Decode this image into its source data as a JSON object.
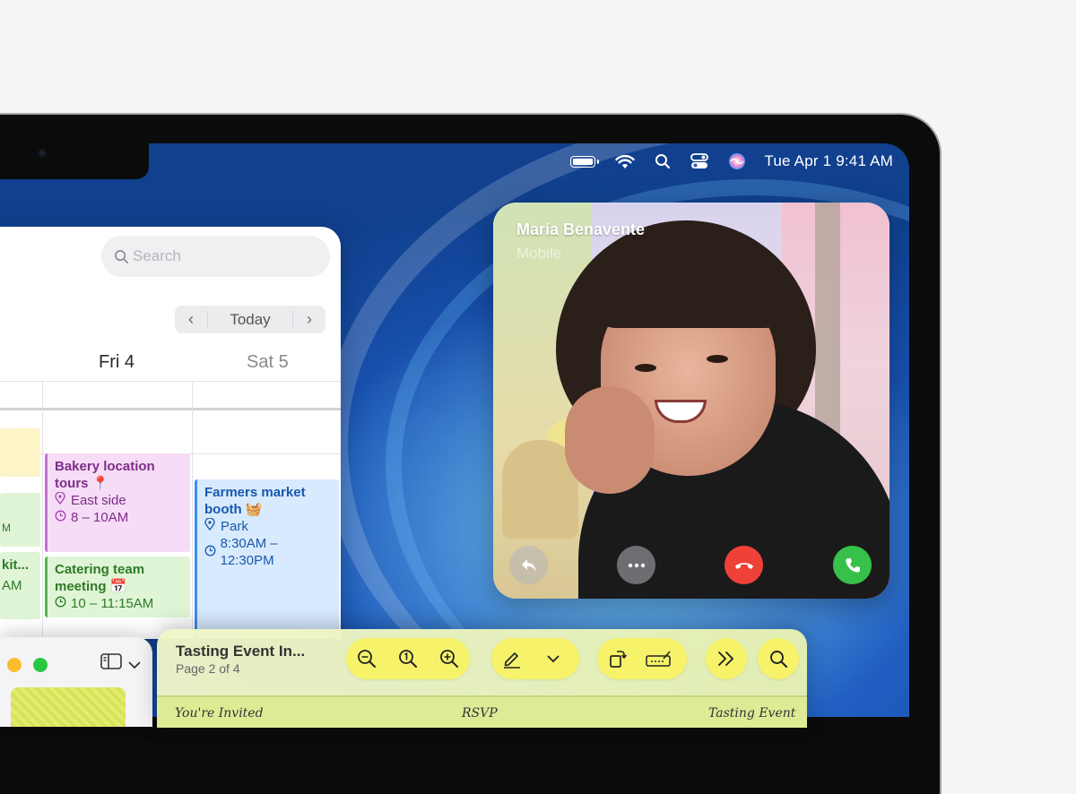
{
  "menubar": {
    "icons": [
      "battery-icon",
      "wifi-icon",
      "spotlight-search-icon",
      "control-center-icon",
      "siri-icon"
    ],
    "clock": "Tue Apr 1  9:41 AM"
  },
  "calendar": {
    "search_placeholder": "Search",
    "nav_today": "Today",
    "nav_prev": "‹",
    "nav_next": "›",
    "days": [
      "Fri 4",
      "Sat 5"
    ],
    "events": {
      "bakery": {
        "title": "Bakery location tours 📍",
        "location": "East side",
        "time": "8 – 10AM"
      },
      "catering": {
        "title": "Catering team meeting 📅",
        "time": "10 – 11:15AM"
      },
      "farmers": {
        "title": "Farmers market booth 🧺",
        "location": "Park",
        "time": "8:30AM – 12:30PM"
      },
      "partial": {
        "title": "kit...",
        "time": "AM"
      },
      "partial2": {
        "time": "M"
      }
    }
  },
  "facetime": {
    "caller_name": "María Benavente",
    "caller_sub": "Mobile",
    "buttons": [
      "share-screen-button",
      "more-button",
      "decline-button",
      "accept-button"
    ]
  },
  "preview": {
    "title": "Tasting Event In...",
    "page_label": "Page 2 of 4",
    "doc_texts": [
      "You're Invited",
      "RSVP",
      "Tasting Event"
    ]
  },
  "colors": {
    "decline": "#f04138",
    "accept": "#37c04a",
    "event_pink": "#c56ed4",
    "event_green": "#55b84a",
    "event_blue": "#3b8ff0",
    "preview_toolbar": "#f6f36a"
  }
}
